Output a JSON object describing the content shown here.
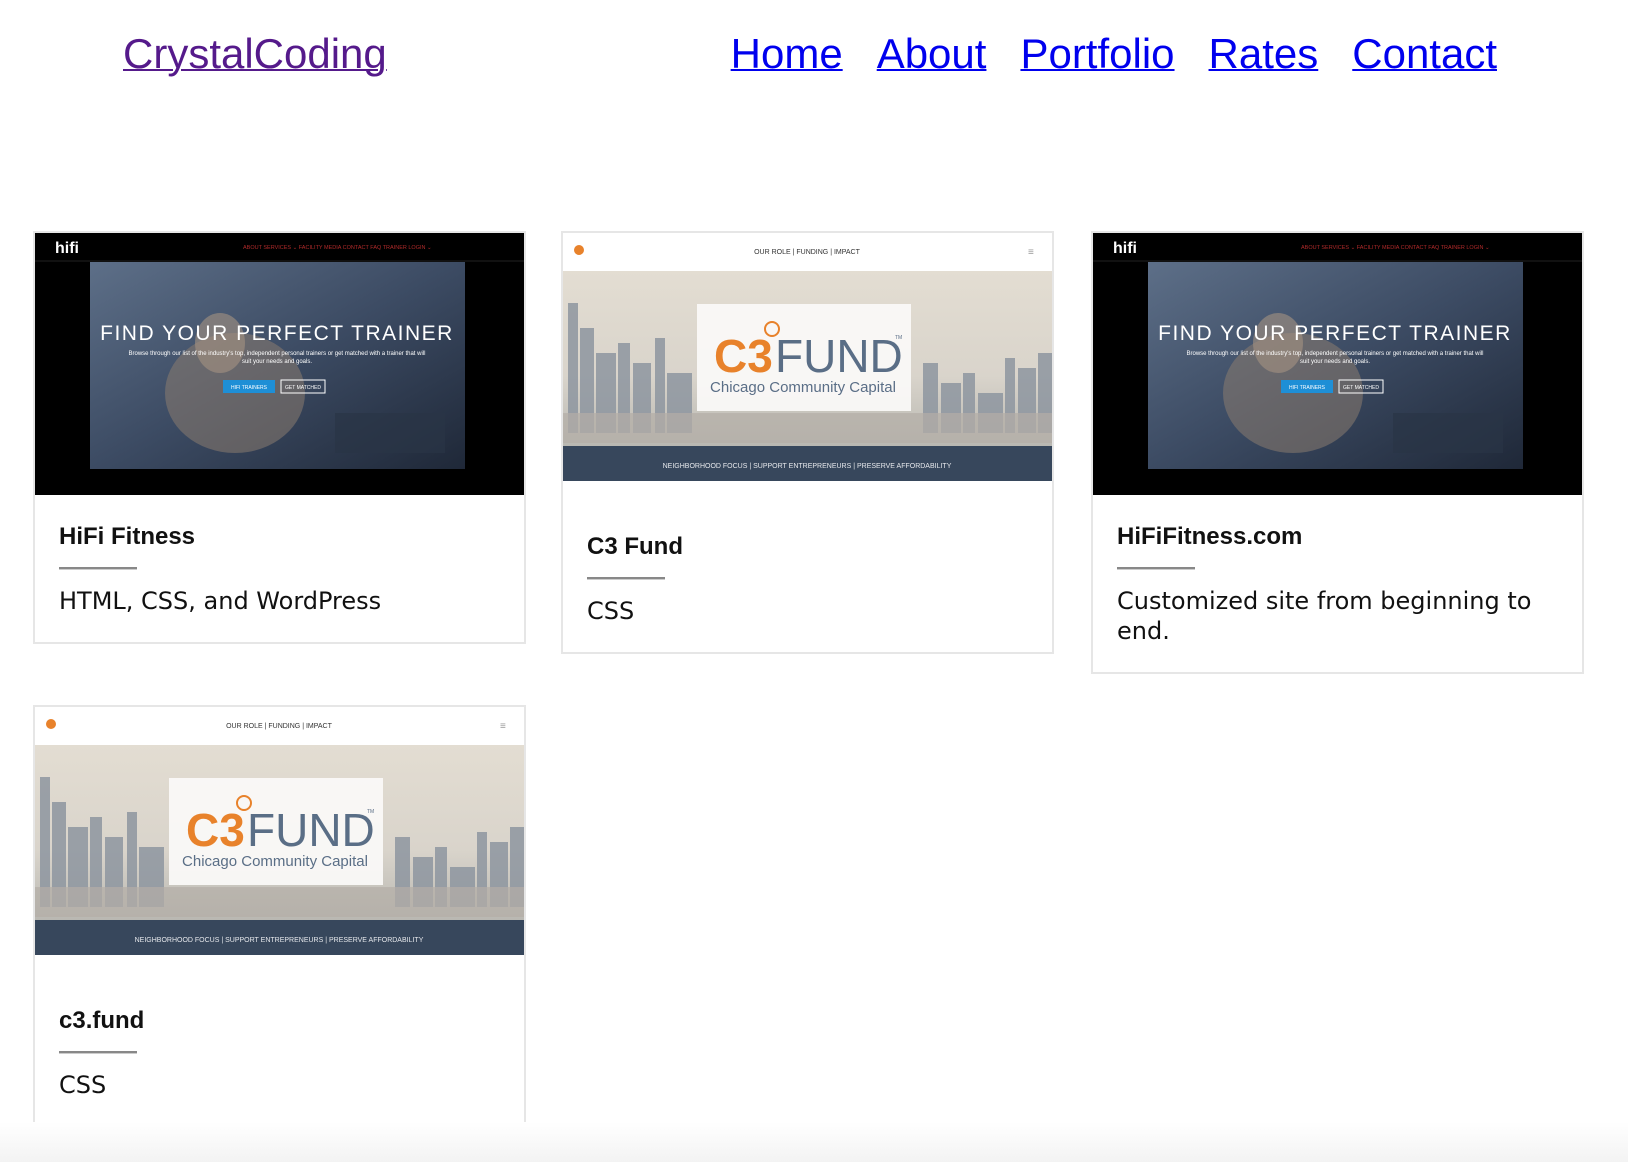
{
  "header": {
    "brand": "CrystalCoding",
    "nav": [
      "Home",
      "About",
      "Portfolio",
      "Rates",
      "Contact"
    ]
  },
  "hifi_thumb": {
    "logo": "hifi",
    "menu": "ABOUT   SERVICES ⌄   FACILITY   MEDIA   CONTACT   FAQ   TRAINER LOGIN ⌄",
    "headline": "FIND YOUR PERFECT TRAINER",
    "subline1": "Browse through our list of the industry's top, independent personal trainers or get matched with a trainer that will",
    "subline2": "suit your needs and goals.",
    "button1": "HIFI TRAINERS",
    "button2": "GET MATCHED"
  },
  "c3_thumb": {
    "menu": "OUR ROLE   |   FUNDING   |   IMPACT",
    "logo_c3": "C3",
    "logo_fund": "FUND",
    "tm": "TM",
    "tagline": "Chicago Community Capital",
    "footer": "NEIGHBORHOOD FOCUS   |   SUPPORT ENTREPRENEURS   |   PRESERVE AFFORDABILITY"
  },
  "cards": [
    {
      "title": "HiFi Fitness",
      "description": "HTML, CSS, and WordPress"
    },
    {
      "title": "C3 Fund",
      "description": "CSS"
    },
    {
      "title": "HiFiFitness.com",
      "description": "Customized site from beginning to end."
    },
    {
      "title": "c3.fund",
      "description": "CSS"
    }
  ],
  "colors": {
    "visited_link": "#551a8b",
    "link": "#0000ee",
    "c3_orange": "#e8822b",
    "card_border": "#e6e6e6"
  }
}
